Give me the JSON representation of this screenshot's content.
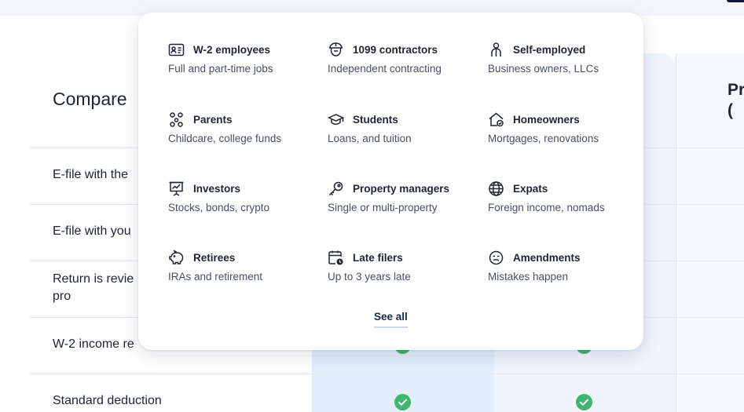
{
  "page": {
    "compare_title": "Compare",
    "right_column_header": "Pr\n(",
    "features": [
      "E-file with the",
      "E-file with you",
      "Return is revie\npro",
      "W-2 income re",
      "Standard deduction"
    ]
  },
  "menu": {
    "items": [
      {
        "title": "W-2 employees",
        "subtitle": "Full and part-time jobs",
        "icon": "id-card-icon"
      },
      {
        "title": "1099 contractors",
        "subtitle": "Independent contracting",
        "icon": "contractor-icon"
      },
      {
        "title": "Self-employed",
        "subtitle": "Business owners, LLCs",
        "icon": "person-icon"
      },
      {
        "title": "Parents",
        "subtitle": "Childcare, college funds",
        "icon": "family-icon"
      },
      {
        "title": "Students",
        "subtitle": "Loans, and tuition",
        "icon": "graduation-cap-icon"
      },
      {
        "title": "Homeowners",
        "subtitle": "Mortgages, renovations",
        "icon": "house-check-icon"
      },
      {
        "title": "Investors",
        "subtitle": "Stocks, bonds, crypto",
        "icon": "chart-board-icon"
      },
      {
        "title": "Property managers",
        "subtitle": "Single or multi-property",
        "icon": "key-icon"
      },
      {
        "title": "Expats",
        "subtitle": "Foreign income, nomads",
        "icon": "globe-icon"
      },
      {
        "title": "Retirees",
        "subtitle": "IRAs and retirement",
        "icon": "piggy-bank-icon"
      },
      {
        "title": "Late filers",
        "subtitle": "Up to 3 years late",
        "icon": "calendar-clock-icon"
      },
      {
        "title": "Amendments",
        "subtitle": "Mistakes happen",
        "icon": "face-icon"
      }
    ],
    "see_all": "See all"
  },
  "colors": {
    "check": "#3fb56d",
    "highlight_column": "#e3eefb",
    "link": "#14284d"
  }
}
